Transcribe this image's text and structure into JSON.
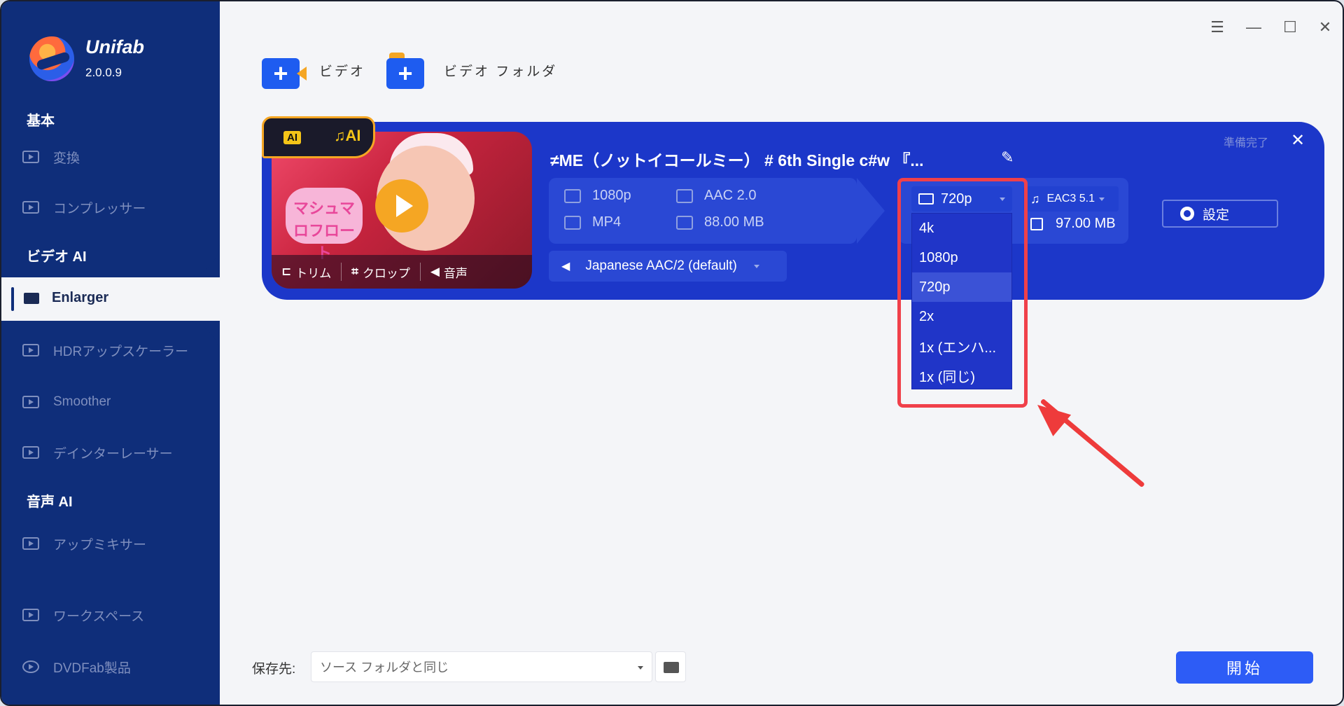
{
  "app": {
    "brand": "Unifab",
    "version": "2.0.0.9"
  },
  "sidebar": {
    "sections": [
      {
        "label": "基本"
      },
      {
        "label": "ビデオ AI"
      },
      {
        "label": "音声 AI"
      }
    ],
    "items": [
      {
        "label": "変換",
        "icon": "convert-icon"
      },
      {
        "label": "コンプレッサー",
        "icon": "compressor-icon"
      },
      {
        "label": "Enlarger",
        "icon": "enlarger-icon",
        "active": true
      },
      {
        "label": "HDRアップスケーラー",
        "icon": "hdr-icon"
      },
      {
        "label": "Smoother",
        "icon": "smoother-icon"
      },
      {
        "label": "デインターレーサー",
        "icon": "deinterlacer-icon"
      },
      {
        "label": "アップミキサー",
        "icon": "upmixer-icon"
      },
      {
        "label": "ワークスペース",
        "icon": "workspace-icon"
      },
      {
        "label": "DVDFab製品",
        "icon": "dvdfab-icon"
      }
    ]
  },
  "toolbar": {
    "add_video": "ビデオ",
    "add_folder": "ビデオ フォルダ"
  },
  "task": {
    "title": "≠ME（ノットイコールミー） # 6th Single c#w 『...",
    "status": "準備完了",
    "badge_ai_video": "AI",
    "badge_ai_audio": "♫AI",
    "thumb_text": "マシュマロフロート",
    "tools": {
      "trim": "トリム",
      "crop": "クロップ",
      "audio": "音声"
    },
    "source": {
      "resolution": "1080p",
      "format": "MP4",
      "audio": "AAC 2.0",
      "size": "88.00 MB"
    },
    "target": {
      "resolution": "720p",
      "audio": "EAC3 5.1",
      "size": "97.00 MB"
    },
    "audio_track": "Japanese AAC/2 (default)",
    "settings_label": "設定",
    "resolution_options": [
      "4k",
      "1080p",
      "720p",
      "2x",
      "1x (エンハ...",
      "1x (同じ)"
    ],
    "selected_option": "720p"
  },
  "bottom": {
    "save_label": "保存先:",
    "save_value": "ソース フォルダと同じ",
    "start_label": "開始"
  },
  "colors": {
    "sidebar": "#0f2e7a",
    "card": "#1c37c9",
    "accent": "#2d5cf6",
    "highlight": "#f0404a"
  }
}
